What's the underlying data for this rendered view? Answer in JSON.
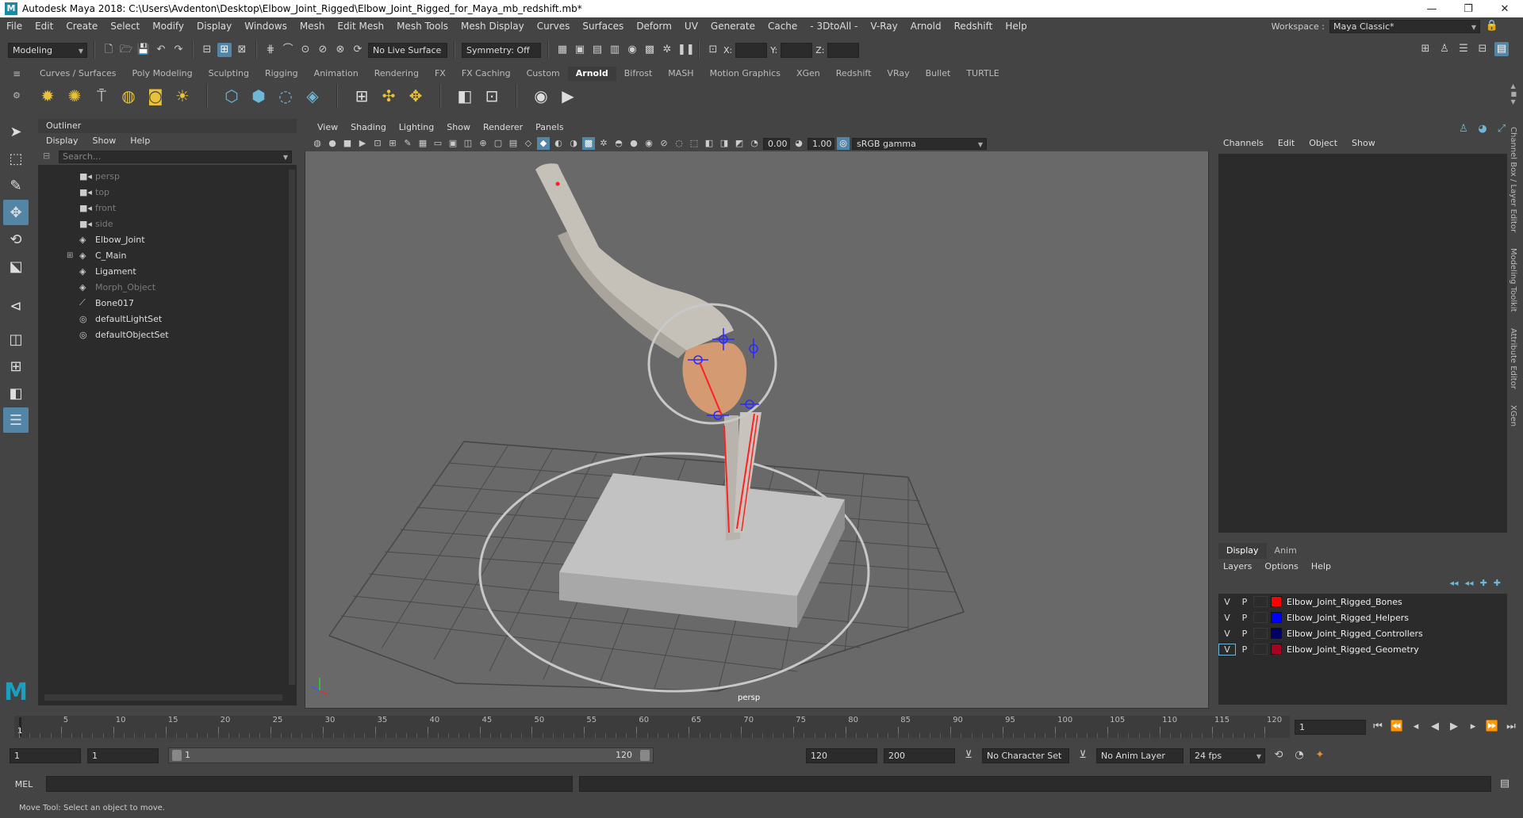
{
  "window": {
    "logo": "M",
    "title": "Autodesk Maya 2018: C:\\Users\\Avdenton\\Desktop\\Elbow_Joint_Rigged\\Elbow_Joint_Rigged_for_Maya_mb_redshift.mb*",
    "minimize": "—",
    "maximize": "❐",
    "close": "✕"
  },
  "menubar": [
    "File",
    "Edit",
    "Create",
    "Select",
    "Modify",
    "Display",
    "Windows",
    "Mesh",
    "Edit Mesh",
    "Mesh Tools",
    "Mesh Display",
    "Curves",
    "Surfaces",
    "Deform",
    "UV",
    "Generate",
    "Cache",
    "- 3DtoAll -",
    "V-Ray",
    "Arnold",
    "Redshift",
    "Help"
  ],
  "workspace": {
    "label": "Workspace :",
    "value": "Maya Classic*"
  },
  "statusline": {
    "mode": "Modeling",
    "live_surface": "No Live Surface",
    "symmetry": "Symmetry: Off",
    "x_label": "X:",
    "y_label": "Y:",
    "z_label": "Z:"
  },
  "shelf": {
    "tabs": [
      "Curves / Surfaces",
      "Poly Modeling",
      "Sculpting",
      "Rigging",
      "Animation",
      "Rendering",
      "FX",
      "FX Caching",
      "Custom",
      "Arnold",
      "Bifrost",
      "MASH",
      "Motion Graphics",
      "XGen",
      "Redshift",
      "VRay",
      "Bullet",
      "TURTLE"
    ],
    "active": "Arnold"
  },
  "outliner": {
    "title": "Outliner",
    "menu": [
      "Display",
      "Show",
      "Help"
    ],
    "search_placeholder": "Search...",
    "items": [
      {
        "label": "persp",
        "icon": "camera-icon",
        "dim": true
      },
      {
        "label": "top",
        "icon": "camera-icon",
        "dim": true
      },
      {
        "label": "front",
        "icon": "camera-icon",
        "dim": true
      },
      {
        "label": "side",
        "icon": "camera-icon",
        "dim": true
      },
      {
        "label": "Elbow_Joint",
        "icon": "transform-icon",
        "dim": false
      },
      {
        "label": "C_Main",
        "icon": "transform-icon",
        "dim": false,
        "expandable": true
      },
      {
        "label": "Ligament",
        "icon": "transform-icon",
        "dim": false
      },
      {
        "label": "Morph_Object",
        "icon": "transform-icon",
        "dim": true
      },
      {
        "label": "Bone017",
        "icon": "joint-icon",
        "dim": false
      },
      {
        "label": "defaultLightSet",
        "icon": "set-icon",
        "dim": false
      },
      {
        "label": "defaultObjectSet",
        "icon": "set-icon",
        "dim": false
      }
    ]
  },
  "viewport": {
    "menu": [
      "View",
      "Shading",
      "Lighting",
      "Show",
      "Renderer",
      "Panels"
    ],
    "exposure": "0.00",
    "gamma": "1.00",
    "color_space": "sRGB gamma",
    "camera_label": "persp"
  },
  "channelbox": {
    "menu": [
      "Channels",
      "Edit",
      "Object",
      "Show"
    ]
  },
  "layers": {
    "tabs": [
      "Display",
      "Anim"
    ],
    "menu": [
      "Layers",
      "Options",
      "Help"
    ],
    "rows": [
      {
        "v": "V",
        "p": "P",
        "color": "#ff0000",
        "name": "Elbow_Joint_Rigged_Bones"
      },
      {
        "v": "V",
        "p": "P",
        "color": "#0000ff",
        "name": "Elbow_Joint_Rigged_Helpers"
      },
      {
        "v": "V",
        "p": "P",
        "color": "#000066",
        "name": "Elbow_Joint_Rigged_Controllers"
      },
      {
        "v": "V",
        "p": "P",
        "color": "#aa0022",
        "name": "Elbow_Joint_Rigged_Geometry"
      }
    ]
  },
  "sidetabs": [
    "Channel Box / Layer Editor",
    "Modeling Toolkit",
    "Attribute Editor",
    "XGen"
  ],
  "timeline": {
    "ticks": [
      "1",
      "5",
      "10",
      "15",
      "20",
      "25",
      "30",
      "35",
      "40",
      "45",
      "50",
      "55",
      "60",
      "65",
      "70",
      "75",
      "80",
      "85",
      "90",
      "95",
      "100",
      "105",
      "110",
      "115",
      "120"
    ],
    "current_frame": "1"
  },
  "range": {
    "start": "1",
    "playback_start": "1",
    "slider_start": "1",
    "slider_end": "120",
    "playback_end": "120",
    "end": "200",
    "character_set": "No Character Set",
    "anim_layer": "No Anim Layer",
    "fps": "24 fps"
  },
  "command": {
    "label": "MEL"
  },
  "helpline": "Move Tool: Select an object to move."
}
